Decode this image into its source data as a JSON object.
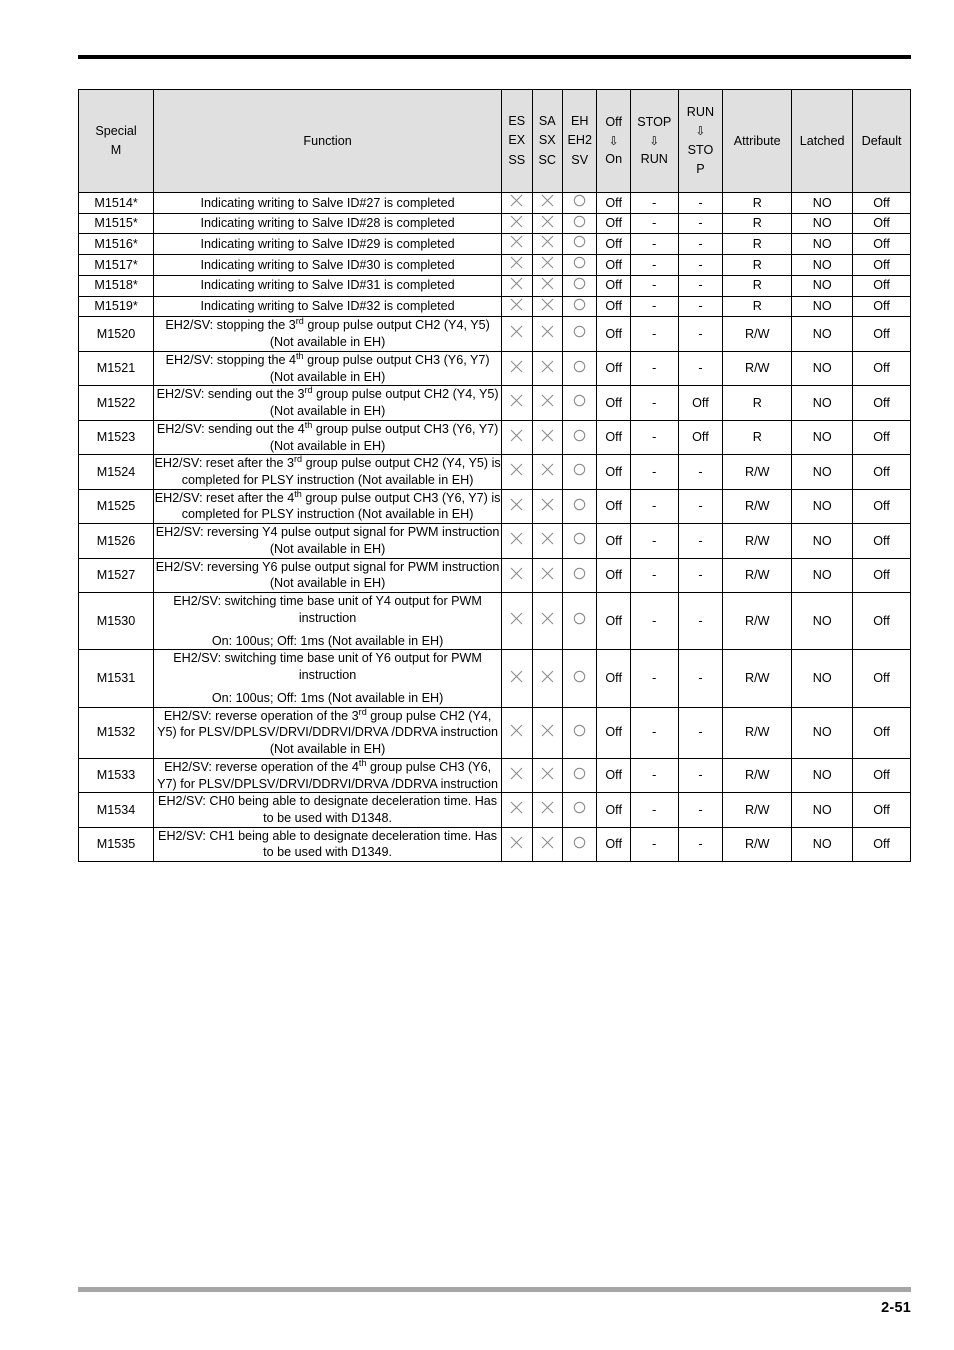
{
  "document": {
    "page_number": "2-51"
  },
  "table": {
    "headers": {
      "special_m": [
        "Special",
        "M"
      ],
      "function": "Function",
      "series_1": [
        "ES",
        "EX",
        "SS"
      ],
      "series_2": [
        "SA",
        "SX",
        "SC"
      ],
      "series_3": [
        "EH",
        "EH2",
        "SV"
      ],
      "off_on": [
        "Off",
        "⇩",
        "On"
      ],
      "stop_run": [
        "STOP",
        "⇩",
        "RUN"
      ],
      "run_stop": [
        "RUN",
        "⇩",
        "STO",
        "P"
      ],
      "attribute": "Attribute",
      "latched": "Latched",
      "default": "Default"
    },
    "symbols": {
      "cross": "cross-mark",
      "circle": "circle-mark"
    },
    "rows": [
      {
        "special_m": "M1514*",
        "function_lines": [
          "Indicating writing to Salve ID#27 is completed"
        ],
        "s1": "cross",
        "s2": "cross",
        "s3": "circle",
        "off_on": "Off",
        "stop_run": "-",
        "run_stop": "-",
        "attribute": "R",
        "latched": "NO",
        "default": "Off",
        "default_align": "middle"
      },
      {
        "special_m": "M1515*",
        "function_lines": [
          "Indicating writing to Salve ID#28 is completed"
        ],
        "s1": "cross",
        "s2": "cross",
        "s3": "circle",
        "off_on": "Off",
        "stop_run": "-",
        "run_stop": "-",
        "attribute": "R",
        "latched": "NO",
        "default": "Off",
        "default_align": "middle"
      },
      {
        "special_m": "M1516*",
        "function_lines": [
          "Indicating writing to Salve ID#29 is completed"
        ],
        "s1": "cross",
        "s2": "cross",
        "s3": "circle",
        "off_on": "Off",
        "stop_run": "-",
        "run_stop": "-",
        "attribute": "R",
        "latched": "NO",
        "default": "Off",
        "default_align": "middle"
      },
      {
        "special_m": "M1517*",
        "function_lines": [
          "Indicating writing to Salve ID#30 is completed"
        ],
        "s1": "cross",
        "s2": "cross",
        "s3": "circle",
        "off_on": "Off",
        "stop_run": "-",
        "run_stop": "-",
        "attribute": "R",
        "latched": "NO",
        "default": "Off",
        "default_align": "middle"
      },
      {
        "special_m": "M1518*",
        "function_lines": [
          "Indicating writing to Salve ID#31 is completed"
        ],
        "s1": "cross",
        "s2": "cross",
        "s3": "circle",
        "off_on": "Off",
        "stop_run": "-",
        "run_stop": "-",
        "attribute": "R",
        "latched": "NO",
        "default": "Off",
        "default_align": "middle"
      },
      {
        "special_m": "M1519*",
        "function_lines": [
          "Indicating writing to Salve ID#32 is completed"
        ],
        "s1": "cross",
        "s2": "cross",
        "s3": "circle",
        "off_on": "Off",
        "stop_run": "-",
        "run_stop": "-",
        "attribute": "R",
        "latched": "NO",
        "default": "Off",
        "default_align": "middle"
      },
      {
        "special_m": "M1520",
        "function_html": "EH2/SV: stopping the 3<sup>rd</sup> group pulse output CH2 (Y4, Y5) (Not available in EH)",
        "s1": "cross",
        "s2": "cross",
        "s3": "circle",
        "off_on": "Off",
        "stop_run": "-",
        "run_stop": "-",
        "attribute": "R/W",
        "latched": "NO",
        "default": "Off",
        "default_align": "middle"
      },
      {
        "special_m": "M1521",
        "function_html": "EH2/SV: stopping the 4<sup>th</sup> group pulse output CH3 (Y6, Y7) (Not available in EH)",
        "s1": "cross",
        "s2": "cross",
        "s3": "circle",
        "off_on": "Off",
        "stop_run": "-",
        "run_stop": "-",
        "attribute": "R/W",
        "latched": "NO",
        "default": "Off",
        "default_align": "middle"
      },
      {
        "special_m": "M1522",
        "function_html": "EH2/SV: sending out the 3<sup>rd</sup> group pulse output CH2 (Y4, Y5) (Not available in EH)",
        "s1": "cross",
        "s2": "cross",
        "s3": "circle",
        "off_on": "Off",
        "stop_run": "-",
        "run_stop": "Off",
        "attribute": "R",
        "latched": "NO",
        "default": "Off",
        "default_align": "middle"
      },
      {
        "special_m": "M1523",
        "function_html": "EH2/SV: sending out the 4<sup>th</sup> group pulse output CH3 (Y6, Y7) (Not available in EH)",
        "s1": "cross",
        "s2": "cross",
        "s3": "circle",
        "off_on": "Off",
        "stop_run": "-",
        "run_stop": "Off",
        "attribute": "R",
        "latched": "NO",
        "default": "Off",
        "default_align": "middle"
      },
      {
        "special_m": "M1524",
        "function_html": "EH2/SV: reset after the 3<sup>rd</sup> group pulse output CH2 (Y4, Y5) is completed for PLSY instruction (Not available in EH)",
        "s1": "cross",
        "s2": "cross",
        "s3": "circle",
        "off_on": "Off",
        "stop_run": "-",
        "run_stop": "-",
        "attribute": "R/W",
        "latched": "NO",
        "default": "Off",
        "default_align": "middle"
      },
      {
        "special_m": "M1525",
        "function_html": "EH2/SV: reset after the 4<sup>th</sup> group pulse output CH3 (Y6, Y7) is completed for PLSY instruction (Not available in EH)",
        "s1": "cross",
        "s2": "cross",
        "s3": "circle",
        "off_on": "Off",
        "stop_run": "-",
        "run_stop": "-",
        "attribute": "R/W",
        "latched": "NO",
        "default": "Off",
        "default_align": "middle"
      },
      {
        "special_m": "M1526",
        "function_html": "EH2/SV: reversing Y4 pulse output signal for PWM instruction (Not available in EH)",
        "s1": "cross",
        "s2": "cross",
        "s3": "circle",
        "off_on": "Off",
        "stop_run": "-",
        "run_stop": "-",
        "attribute": "R/W",
        "latched": "NO",
        "default": "Off",
        "default_align": "middle"
      },
      {
        "special_m": "M1527",
        "function_html": "EH2/SV: reversing Y6 pulse output signal for PWM instruction (Not available in EH)",
        "s1": "cross",
        "s2": "cross",
        "s3": "circle",
        "off_on": "Off",
        "stop_run": "-",
        "run_stop": "-",
        "attribute": "R/W",
        "latched": "NO",
        "default": "Off",
        "default_align": "middle"
      },
      {
        "special_m": "M1530",
        "function_paragraphs": [
          "EH2/SV: switching time base unit of Y4 output for PWM instruction",
          "On: 100us; Off: 1ms (Not available in EH)"
        ],
        "s1": "cross",
        "s2": "cross",
        "s3": "circle",
        "off_on": "Off",
        "stop_run": "-",
        "run_stop": "-",
        "attribute": "R/W",
        "latched": "NO",
        "default": "Off",
        "default_align": "middle"
      },
      {
        "special_m": "M1531",
        "function_paragraphs": [
          "EH2/SV: switching time base unit of Y6 output for PWM instruction",
          "On: 100us; Off: 1ms (Not available in EH)"
        ],
        "s1": "cross",
        "s2": "cross",
        "s3": "circle",
        "off_on": "Off",
        "stop_run": "-",
        "run_stop": "-",
        "attribute": "R/W",
        "latched": "NO",
        "default": "Off",
        "default_align": "middle"
      },
      {
        "special_m": "M1532",
        "function_html": "EH2/SV: reverse operation of the 3<sup>rd</sup> group pulse CH2 (Y4, Y5) for PLSV/DPLSV/DRVI/DDRVI/DRVA /DDRVA instruction (Not available in EH)",
        "s1": "cross",
        "s2": "cross",
        "s3": "circle",
        "off_on": "Off",
        "stop_run": "-",
        "run_stop": "-",
        "attribute": "R/W",
        "latched": "NO",
        "default": "Off",
        "default_align": "middle"
      },
      {
        "special_m": "M1533",
        "function_html": "EH2/SV: reverse operation of the 4<sup>th</sup> group pulse CH3 (Y6, Y7) for PLSV/DPLSV/DRVI/DDRVI/DRVA /DDRVA instruction",
        "s1": "cross",
        "s2": "cross",
        "s3": "circle",
        "off_on": "Off",
        "stop_run": "-",
        "run_stop": "-",
        "attribute": "R/W",
        "latched": "NO",
        "default": "Off",
        "default_align": "middle"
      },
      {
        "special_m": "M1534",
        "function_html": "EH2/SV: CH0 being able to designate deceleration time. Has to be used with D1348.",
        "s1": "cross",
        "s2": "cross",
        "s3": "circle",
        "off_on": "Off",
        "stop_run": "-",
        "run_stop": "-",
        "attribute": "R/W",
        "latched": "NO",
        "default": "Off",
        "default_align": "top"
      },
      {
        "special_m": "M1535",
        "function_html": "EH2/SV: CH1 being able to designate deceleration time. Has to be used with D1349.",
        "s1": "cross",
        "s2": "cross",
        "s3": "circle",
        "off_on": "Off",
        "stop_run": "-",
        "run_stop": "-",
        "attribute": "R/W",
        "latched": "NO",
        "default": "Off",
        "default_align": "top"
      }
    ]
  }
}
